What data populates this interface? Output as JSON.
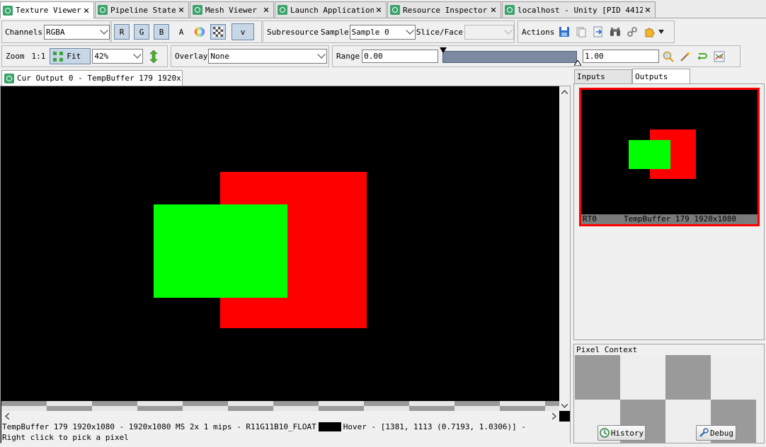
{
  "tabs": [
    {
      "label": "Texture Viewer",
      "active": true
    },
    {
      "label": "Pipeline State",
      "active": false
    },
    {
      "label": "Mesh Viewer",
      "active": false
    },
    {
      "label": "Launch Application",
      "active": false
    },
    {
      "label": "Resource Inspector",
      "active": false
    },
    {
      "label": "localhost - Unity [PID 4412]",
      "active": false
    }
  ],
  "toolbar": {
    "channels_label": "Channels",
    "channels_value": "RGBA",
    "r_label": "R",
    "g_label": "G",
    "b_label": "B",
    "a_label": "A",
    "more_label": "v",
    "subresource_label": "Subresource",
    "sample_label": "Sample",
    "sample_value": "Sample 0",
    "sliceface_label": "Slice/Face",
    "sliceface_value": "",
    "actions_label": "Actions"
  },
  "toolbar2": {
    "zoom_label": "Zoom",
    "one_to_one_label": "1:1",
    "fit_label": "Fit",
    "zoom_value": "42%",
    "overlay_label": "Overlay",
    "overlay_value": "None",
    "range_label": "Range",
    "range_min": "0.00",
    "range_max": "1.00"
  },
  "main_tab": {
    "label": "Cur Output 0 - TempBuffer 179 1920x1⋯"
  },
  "right_tabs": [
    {
      "label": "Inputs",
      "active": false
    },
    {
      "label": "Outputs",
      "active": true
    }
  ],
  "thumbnail": {
    "slot_label": "RT0",
    "name_label": "TempBuffer 179 1920x1080"
  },
  "pixel_context": {
    "title": "Pixel Context",
    "history_label": "History",
    "debug_label": "Debug"
  },
  "status": {
    "line1": "TempBuffer 179 1920x1080 -  1920x1080 MS 2x 1 mips -  R11G11B10_FLOAT",
    "hover": "Hover - [1381, 1113 (0.7193, 1.0306)] -",
    "line2": "Right click to pick a pixel"
  },
  "colors": {
    "accent_tab_icon": "#3aa36c",
    "red_rect": "#ff0000",
    "green_rect": "#00ff00",
    "selection_border": "#ff0000",
    "range_bar": "#7b8aa0"
  }
}
